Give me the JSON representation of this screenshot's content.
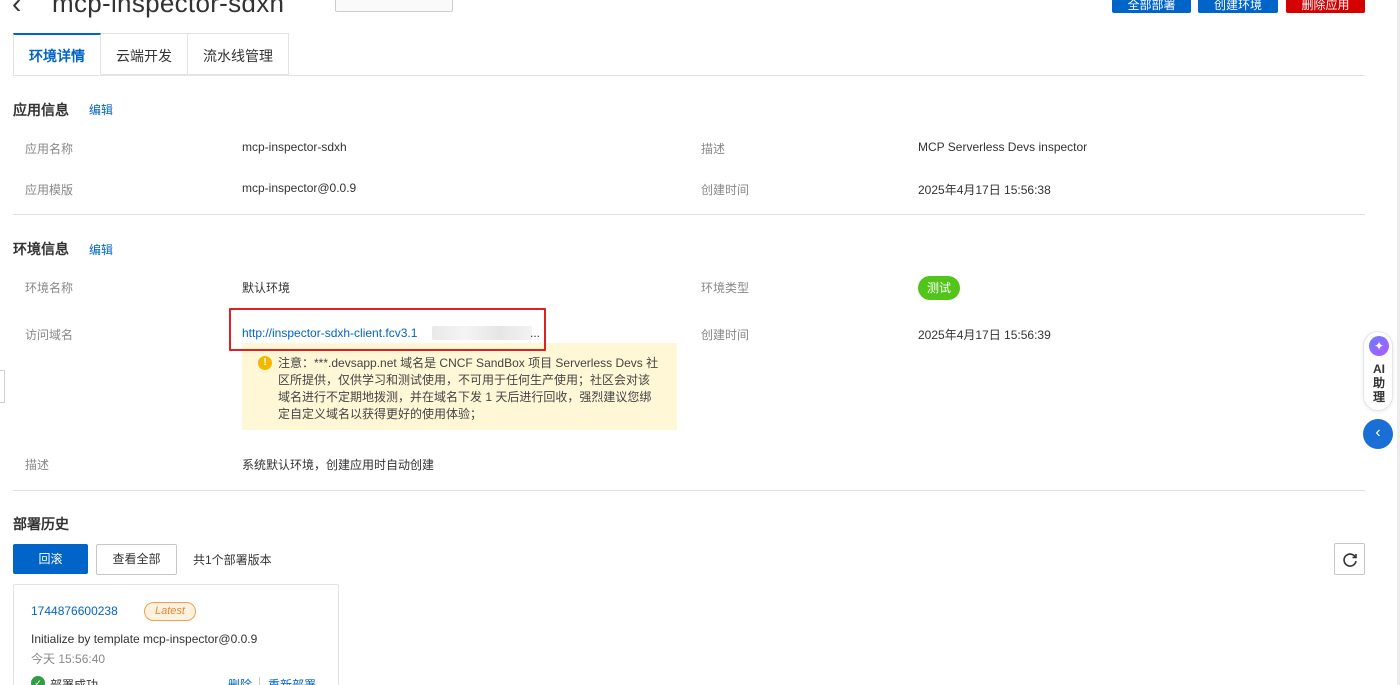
{
  "header": {
    "title": "mcp-inspector-sdxh",
    "input_placeholder": "",
    "buttons": [
      "全部部署",
      "创建环境",
      "删除应用"
    ]
  },
  "tabs": [
    "环境详情",
    "云端开发",
    "流水线管理"
  ],
  "app_info": {
    "title": "应用信息",
    "edit": "编辑",
    "rows": [
      {
        "label": "应用名称",
        "value": "mcp-inspector-sdxh",
        "label2": "描述",
        "value2": "MCP Serverless Devs inspector"
      },
      {
        "label": "应用模版",
        "value": "mcp-inspector@0.0.9",
        "label2": "创建时间",
        "value2": "2025年4月17日 15:56:38"
      }
    ]
  },
  "env_info": {
    "title": "环境信息",
    "edit": "编辑",
    "name_label": "环境名称",
    "name_value": "默认环境",
    "type_label": "环境类型",
    "type_value": "测试",
    "domain_label": "访问域名",
    "domain_value": "http://inspector-sdxh-client.fcv3.1",
    "domain_ellipsis": "...",
    "created_label": "创建时间",
    "created_value": "2025年4月17日 15:56:39",
    "notice": "注意：***.devsapp.net 域名是 CNCF SandBox 项目 Serverless Devs 社区所提供，仅供学习和测试使用，不可用于任何生产使用；社区会对该域名进行不定期地拨测，并在域名下发 1 天后进行回收，强烈建议您绑定自定义域名以获得更好的使用体验；",
    "desc_label": "描述",
    "desc_value": "系统默认环境，创建应用时自动创建"
  },
  "deploy_history": {
    "title": "部署历史",
    "rollback": "回滚",
    "view_all": "查看全部",
    "count_text": "共1个部署版本",
    "card": {
      "id": "1744876600238",
      "badge": "Latest",
      "desc": "Initialize by template mcp-inspector@0.0.9",
      "time": "今天 15:56:40",
      "status": "部署成功",
      "delete": "删除",
      "redeploy": "重新部署"
    }
  },
  "ai_assistant": {
    "label": "AI助理",
    "chars": [
      "AI",
      "助",
      "理"
    ]
  },
  "colors": {
    "primary": "#0064c8",
    "danger": "#d50000",
    "success": "#52c41a",
    "notice_bg": "#fff7d6",
    "highlight": "#e02020"
  }
}
